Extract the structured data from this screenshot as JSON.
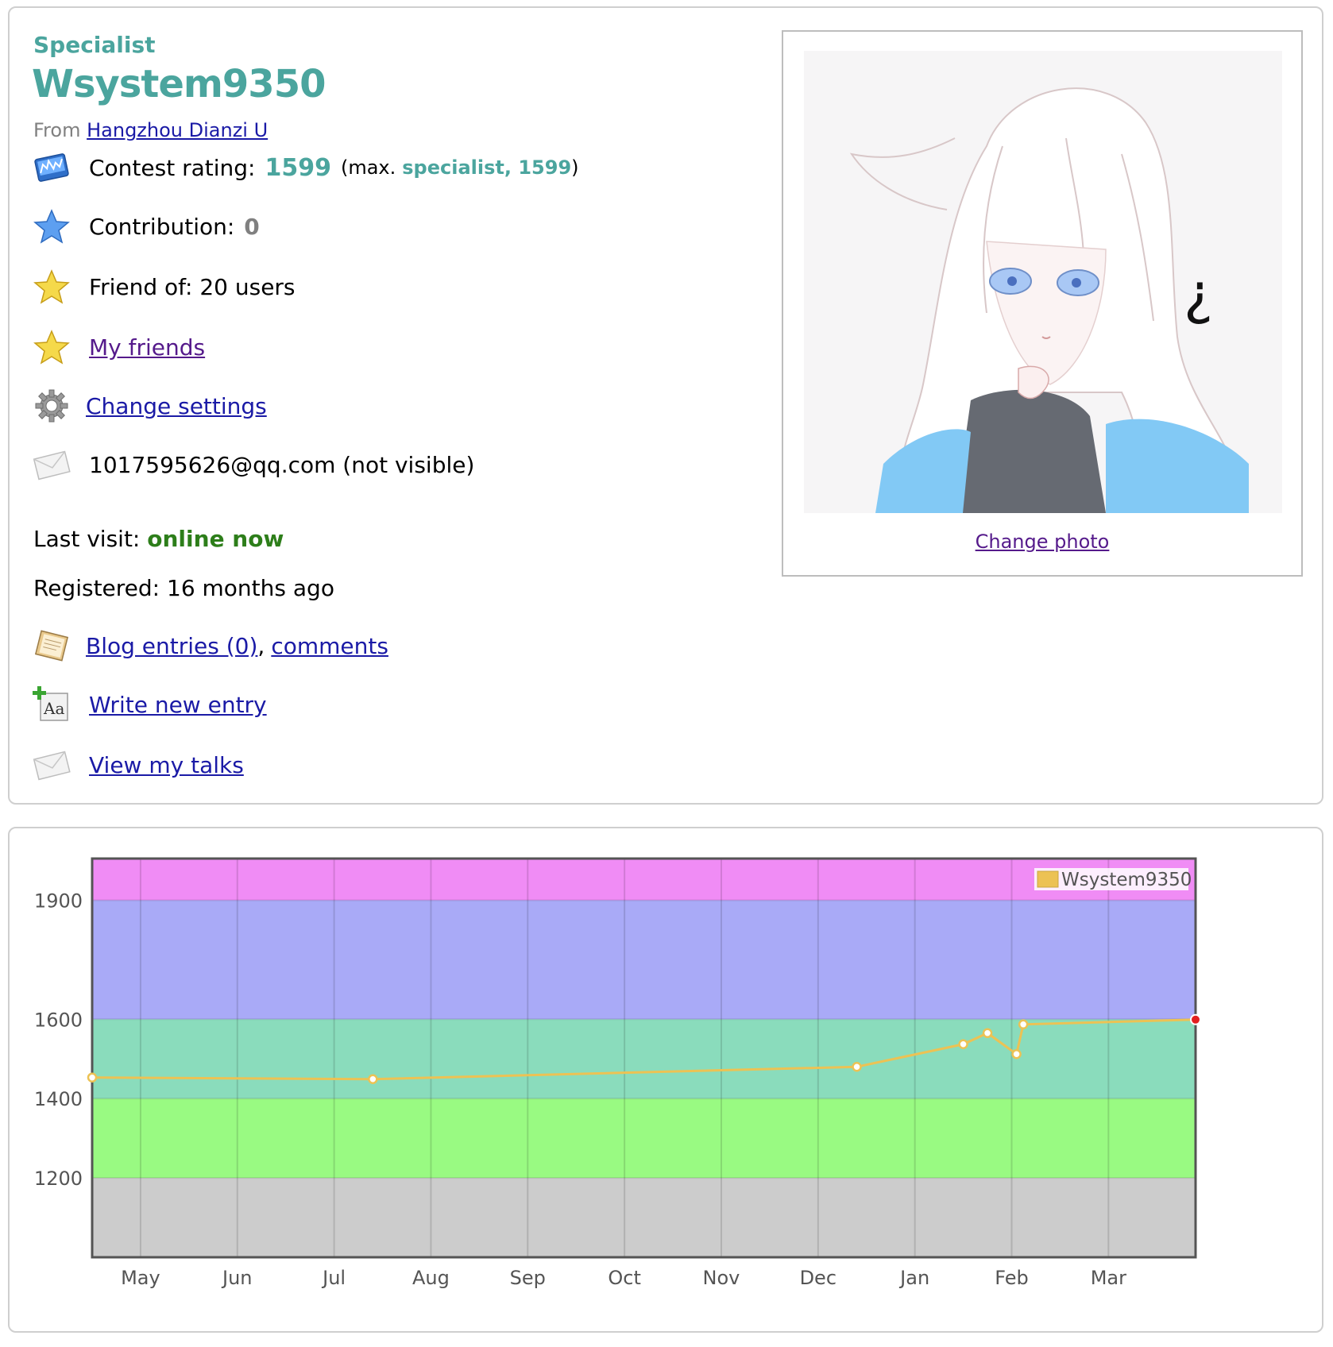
{
  "profile": {
    "rank": "Specialist",
    "handle": "Wsystem9350",
    "from_label": "From",
    "organization": "Hangzhou Dianzi U",
    "contest_rating_label": "Contest rating:",
    "contest_rating": "1599",
    "max_open": "(max.",
    "max_rank_rating": "specialist, 1599",
    "max_close": ")",
    "contribution_label": "Contribution:",
    "contribution": "0",
    "friend_of": "Friend of: 20 users",
    "my_friends": "My friends",
    "change_settings": "Change settings",
    "email": "1017595626@qq.com (not visible)",
    "last_visit_label": "Last visit:",
    "last_visit": "online now",
    "registered": "Registered: 16 months ago",
    "blog_entries": "Blog entries (0)",
    "comma": ",",
    "comments": "comments",
    "write_new_entry": "Write new entry",
    "view_talks": "View my talks",
    "change_photo": "Change photo"
  },
  "icons": {
    "rating": "rating-graph-icon",
    "contribution": "blue-star-icon",
    "friend_of": "gold-star-icon",
    "my_friends": "gold-star-icon",
    "settings": "gear-icon",
    "email": "envelope-icon",
    "blog": "notebook-icon",
    "write": "new-entry-icon",
    "talks": "envelope-icon"
  },
  "colors": {
    "rank": "#4ba59e",
    "online": "#2d7e1a",
    "link": "#1a1aa6",
    "visited": "#551a8b",
    "line": "#ecc254",
    "last_point": "#e21f1f"
  },
  "chart_data": {
    "type": "line",
    "legend": "Wsystem9350",
    "legend_position": "top-right",
    "y_ticks": [
      "1200",
      "1400",
      "1600",
      "1900"
    ],
    "x_ticks": [
      "May",
      "Jun",
      "Jul",
      "Aug",
      "Sep",
      "Oct",
      "Nov",
      "Dec",
      "Jan",
      "Feb",
      "Mar"
    ],
    "ylim": [
      1000,
      2005
    ],
    "xlim": [
      0,
      11.4
    ],
    "x_tick_positions": [
      0.5,
      1.5,
      2.5,
      3.5,
      4.5,
      5.5,
      6.5,
      7.5,
      8.5,
      9.5,
      10.5
    ],
    "bands": [
      {
        "from": 1000,
        "to": 1200,
        "color": "#cccccc"
      },
      {
        "from": 1200,
        "to": 1400,
        "color": "#99fa82"
      },
      {
        "from": 1400,
        "to": 1600,
        "color": "#8adcbc"
      },
      {
        "from": 1600,
        "to": 1900,
        "color": "#a9aaf7"
      },
      {
        "from": 1900,
        "to": 2005,
        "color": "#f08cf5"
      }
    ],
    "points": [
      {
        "x": 0.0,
        "y": 1453
      },
      {
        "x": 2.9,
        "y": 1449
      },
      {
        "x": 7.9,
        "y": 1480
      },
      {
        "x": 9.0,
        "y": 1537
      },
      {
        "x": 9.25,
        "y": 1565
      },
      {
        "x": 9.55,
        "y": 1512
      },
      {
        "x": 9.62,
        "y": 1587
      },
      {
        "x": 11.4,
        "y": 1599
      }
    ],
    "grid": true
  }
}
